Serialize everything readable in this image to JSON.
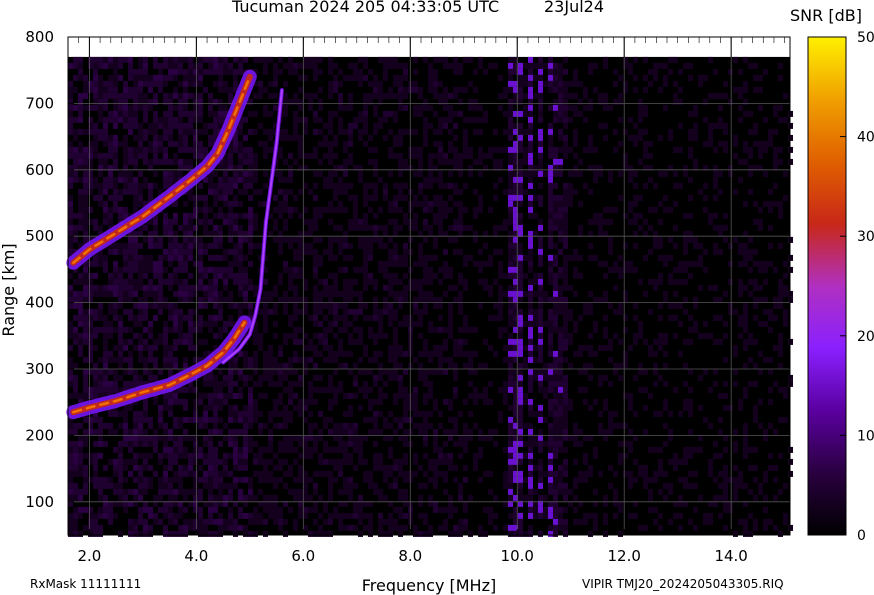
{
  "title": {
    "main": "Tucuman 2024 205 04:33:05 UTC",
    "date": "23Jul24"
  },
  "footer": {
    "rxmask": "RxMask 11111111",
    "file": "VIPIR  TMJ20_2024205043305.RIQ"
  },
  "colorbar": {
    "label": "SNR [dB]",
    "ticks": [
      "50",
      "40",
      "30",
      "20",
      "10",
      "0"
    ],
    "range": [
      0,
      50
    ],
    "colors": [
      "#000000",
      "#2a0040",
      "#5a00a0",
      "#8a20ff",
      "#b030c0",
      "#c82818",
      "#e06000",
      "#f0a000",
      "#fff000"
    ]
  },
  "chart_data": {
    "type": "heatmap",
    "xlabel": "Frequency [MHz]",
    "ylabel": "Range [km]",
    "xlim": [
      1.6,
      15.1
    ],
    "ylim": [
      50,
      800
    ],
    "x_ticks": [
      "2.0",
      "4.0",
      "6.0",
      "8.0",
      "10.0",
      "12.0",
      "14.0"
    ],
    "y_ticks": [
      "800",
      "700",
      "600",
      "500",
      "400",
      "300",
      "200",
      "100"
    ],
    "traces": [
      {
        "name": "lower",
        "points": [
          [
            1.7,
            235
          ],
          [
            2.0,
            242
          ],
          [
            2.5,
            252
          ],
          [
            3.0,
            265
          ],
          [
            3.5,
            276
          ],
          [
            3.9,
            292
          ],
          [
            4.2,
            305
          ],
          [
            4.5,
            325
          ],
          [
            4.7,
            345
          ],
          [
            4.9,
            370
          ]
        ]
      },
      {
        "name": "lower-x",
        "points": [
          [
            4.5,
            310
          ],
          [
            4.8,
            330
          ],
          [
            5.0,
            352
          ],
          [
            5.1,
            380
          ],
          [
            5.2,
            420
          ],
          [
            5.25,
            470
          ],
          [
            5.3,
            520
          ],
          [
            5.4,
            580
          ],
          [
            5.5,
            640
          ],
          [
            5.6,
            720
          ]
        ]
      },
      {
        "name": "upper",
        "points": [
          [
            1.7,
            460
          ],
          [
            2.0,
            480
          ],
          [
            2.5,
            505
          ],
          [
            3.0,
            530
          ],
          [
            3.5,
            560
          ],
          [
            3.9,
            585
          ],
          [
            4.2,
            605
          ],
          [
            4.4,
            625
          ],
          [
            4.6,
            660
          ],
          [
            4.8,
            700
          ],
          [
            5.0,
            740
          ]
        ]
      }
    ],
    "noise_columns": [
      {
        "x": 9.9,
        "intensity": 0.45
      },
      {
        "x": 10.0,
        "intensity": 0.55
      },
      {
        "x": 10.2,
        "intensity": 0.6
      },
      {
        "x": 10.4,
        "intensity": 0.55
      },
      {
        "x": 10.6,
        "intensity": 0.45
      },
      {
        "x": 10.8,
        "intensity": 0.3
      }
    ]
  }
}
